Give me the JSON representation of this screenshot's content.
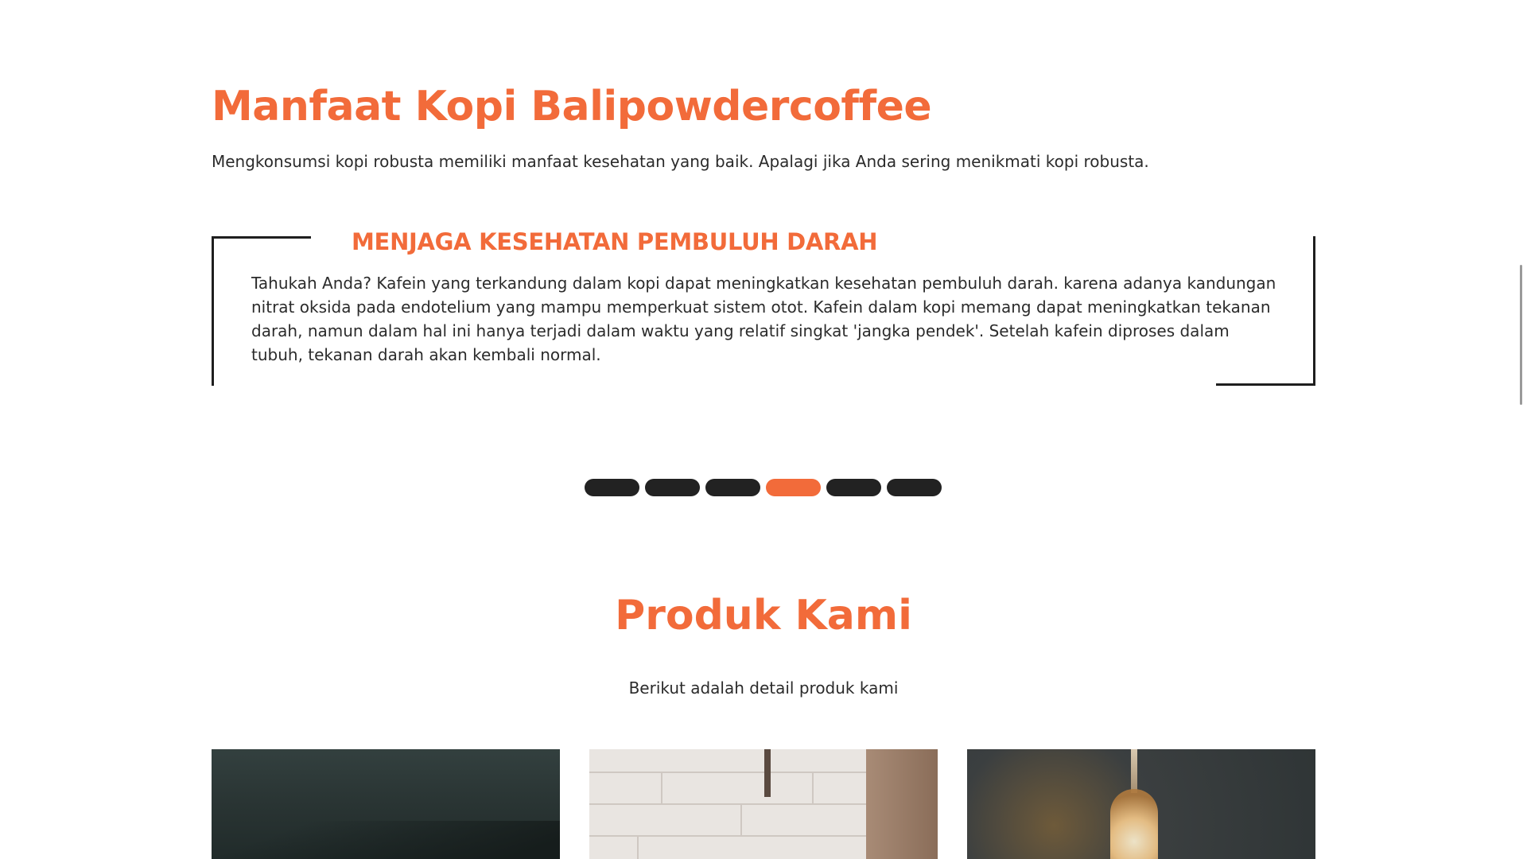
{
  "benefits": {
    "title": "Manfaat Kopi Balipowdercoffee",
    "intro": "Mengkonsumsi kopi robusta memiliki manfaat kesehatan yang baik. Apalagi jika Anda sering menikmati kopi robusta.",
    "slide": {
      "heading": "MENJAGA KESEHATAN PEMBULUH DARAH",
      "text": "Tahukah Anda? Kafein yang terkandung dalam kopi dapat meningkatkan kesehatan pembuluh darah. karena adanya kandungan nitrat oksida pada endotelium yang mampu memperkuat sistem otot. Kafein dalam kopi memang dapat meningkatkan tekanan darah, namun dalam hal ini hanya terjadi dalam waktu yang relatif singkat 'jangka pendek'. Setelah kafein diproses dalam tubuh, tekanan darah akan kembali normal."
    },
    "pagination": {
      "total": 6,
      "active_index": 4
    }
  },
  "products": {
    "title": "Produk Kami",
    "subtitle": "Berikut adalah detail produk kami"
  },
  "colors": {
    "accent": "#f26b3a",
    "dark": "#222222",
    "text": "#2b2b2b"
  }
}
